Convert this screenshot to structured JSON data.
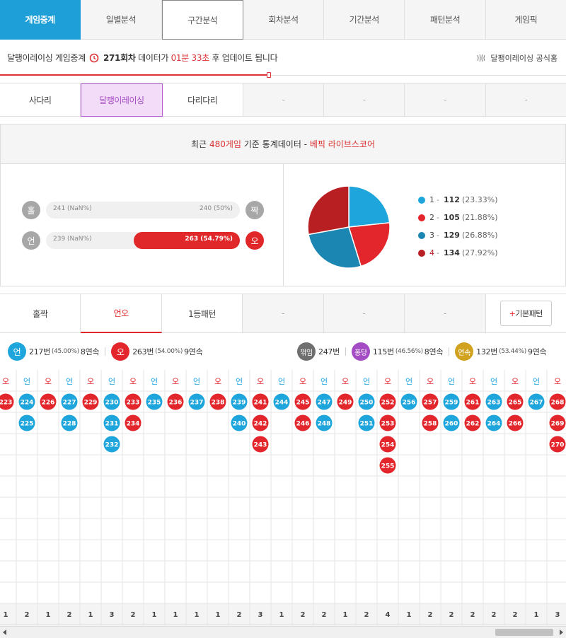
{
  "topnav": [
    {
      "label": "게임중계",
      "state": "blue"
    },
    {
      "label": "일별분석",
      "state": ""
    },
    {
      "label": "구간분석",
      "state": "white"
    },
    {
      "label": "회차분석",
      "state": ""
    },
    {
      "label": "기간분석",
      "state": ""
    },
    {
      "label": "패턴분석",
      "state": ""
    },
    {
      "label": "게임픽",
      "state": ""
    }
  ],
  "update": {
    "prefix": "달팽이레이싱 게임중계",
    "round": "271회차",
    "mid": "데이터가",
    "time": "01분 33초",
    "suffix": "후 업데이트 됩니다",
    "official": "달팽이레이싱 공식홈",
    "progress": 0.476
  },
  "gametabs": [
    {
      "label": "사다리",
      "state": "plain"
    },
    {
      "label": "달팽이레이싱",
      "state": "act"
    },
    {
      "label": "다리다리",
      "state": "plain"
    },
    {
      "label": "-",
      "state": "dash"
    },
    {
      "label": "-",
      "state": "dash"
    },
    {
      "label": "-",
      "state": "dash"
    },
    {
      "label": "-",
      "state": "dash"
    }
  ],
  "stats": {
    "head_pre": "최근",
    "head_count": "480게임",
    "head_mid": "기준 통계데이터 -",
    "head_brand": "베픽 라이브스코어",
    "odd_label": "홀",
    "odd_value": "241 (NaN%)",
    "even_value": "240 (50%)",
    "even_label": "짝",
    "un_label": "언",
    "un_value": "239 (NaN%)",
    "over_value": "263 (54.79%)",
    "over_label": "오",
    "over_share": 0.5479,
    "pie": [
      {
        "num": "1",
        "value": "112",
        "pct": "(23.33%)",
        "color": "#1ea6dc",
        "share": 0.2333
      },
      {
        "num": "2",
        "value": "105",
        "pct": "(21.88%)",
        "color": "#e2262b",
        "share": 0.2188
      },
      {
        "num": "3",
        "value": "129",
        "pct": "(26.88%)",
        "color": "#1c86b3",
        "share": 0.2688
      },
      {
        "num": "4",
        "value": "134",
        "pct": "(27.92%)",
        "color": "#b81f22",
        "share": 0.2792
      }
    ]
  },
  "pattabs": [
    {
      "label": "홀짝",
      "state": "plain"
    },
    {
      "label": "언오",
      "state": "act"
    },
    {
      "label": "1등패턴",
      "state": "plain"
    },
    {
      "label": "-",
      "state": "dash"
    },
    {
      "label": "-",
      "state": "dash"
    },
    {
      "label": "-",
      "state": "dash"
    }
  ],
  "pattern_btn": {
    "plus": "+",
    "label": "기본패턴"
  },
  "summary": {
    "un": {
      "label": "언",
      "count": "217번",
      "pct": "(45.00%)",
      "streak": "8연속"
    },
    "over": {
      "label": "오",
      "count": "263번",
      "pct": "(54.00%)",
      "streak": "9연속"
    },
    "turn": {
      "label": "꺾임",
      "count": "247번"
    },
    "pong": {
      "label": "퐁당",
      "count": "115번",
      "pct": "(46.56%)",
      "streak": "8연속"
    },
    "cont": {
      "label": "연속",
      "count": "132번",
      "pct": "(53.44%)",
      "streak": "9연속"
    }
  },
  "grid": {
    "un_label": "언",
    "over_label": "오",
    "columns": [
      {
        "h": "오",
        "items": [
          "223"
        ],
        "len": "1",
        "idx": "221"
      },
      {
        "h": "언",
        "items": [
          "224",
          "225"
        ],
        "len": "2",
        "idx": "222"
      },
      {
        "h": "오",
        "items": [
          "226"
        ],
        "len": "1",
        "idx": "223"
      },
      {
        "h": "언",
        "items": [
          "227",
          "228"
        ],
        "len": "2",
        "idx": "224"
      },
      {
        "h": "오",
        "items": [
          "229"
        ],
        "len": "1",
        "idx": "225"
      },
      {
        "h": "언",
        "items": [
          "230",
          "231",
          "232"
        ],
        "len": "3",
        "idx": "226"
      },
      {
        "h": "오",
        "items": [
          "233",
          "234"
        ],
        "len": "2",
        "idx": "227"
      },
      {
        "h": "언",
        "items": [
          "235"
        ],
        "len": "1",
        "idx": "228"
      },
      {
        "h": "오",
        "items": [
          "236"
        ],
        "len": "1",
        "idx": "229"
      },
      {
        "h": "언",
        "items": [
          "237"
        ],
        "len": "1",
        "idx": "230"
      },
      {
        "h": "오",
        "items": [
          "238"
        ],
        "len": "1",
        "idx": "231"
      },
      {
        "h": "언",
        "items": [
          "239",
          "240"
        ],
        "len": "2",
        "idx": "232"
      },
      {
        "h": "오",
        "items": [
          "241",
          "242",
          "243"
        ],
        "len": "3",
        "idx": "233"
      },
      {
        "h": "언",
        "items": [
          "244"
        ],
        "len": "1",
        "idx": "234"
      },
      {
        "h": "오",
        "items": [
          "245",
          "246"
        ],
        "len": "2",
        "idx": "235"
      },
      {
        "h": "언",
        "items": [
          "247",
          "248"
        ],
        "len": "2",
        "idx": "236"
      },
      {
        "h": "오",
        "items": [
          "249"
        ],
        "len": "1",
        "idx": "237"
      },
      {
        "h": "언",
        "items": [
          "250",
          "251"
        ],
        "len": "2",
        "idx": "238"
      },
      {
        "h": "오",
        "items": [
          "252",
          "253",
          "254",
          "255"
        ],
        "len": "4",
        "idx": "239"
      },
      {
        "h": "언",
        "items": [
          "256"
        ],
        "len": "1",
        "idx": "240"
      },
      {
        "h": "오",
        "items": [
          "257",
          "258"
        ],
        "len": "2",
        "idx": "241"
      },
      {
        "h": "언",
        "items": [
          "259",
          "260"
        ],
        "len": "2",
        "idx": "242"
      },
      {
        "h": "오",
        "items": [
          "261",
          "262"
        ],
        "len": "2",
        "idx": "243"
      },
      {
        "h": "언",
        "items": [
          "263",
          "264"
        ],
        "len": "2",
        "idx": "244"
      },
      {
        "h": "오",
        "items": [
          "265",
          "266"
        ],
        "len": "2",
        "idx": "245"
      },
      {
        "h": "언",
        "items": [
          "267"
        ],
        "len": "1",
        "idx": "246"
      },
      {
        "h": "오",
        "items": [
          "268",
          "269",
          "270"
        ],
        "len": "3",
        "idx": "247"
      }
    ]
  },
  "colors": {
    "blue": "#1ea6dc",
    "red": "#e2262b",
    "purple": "#a44cc3",
    "gray": "#6f6f6f",
    "gold": "#d0a21f"
  }
}
